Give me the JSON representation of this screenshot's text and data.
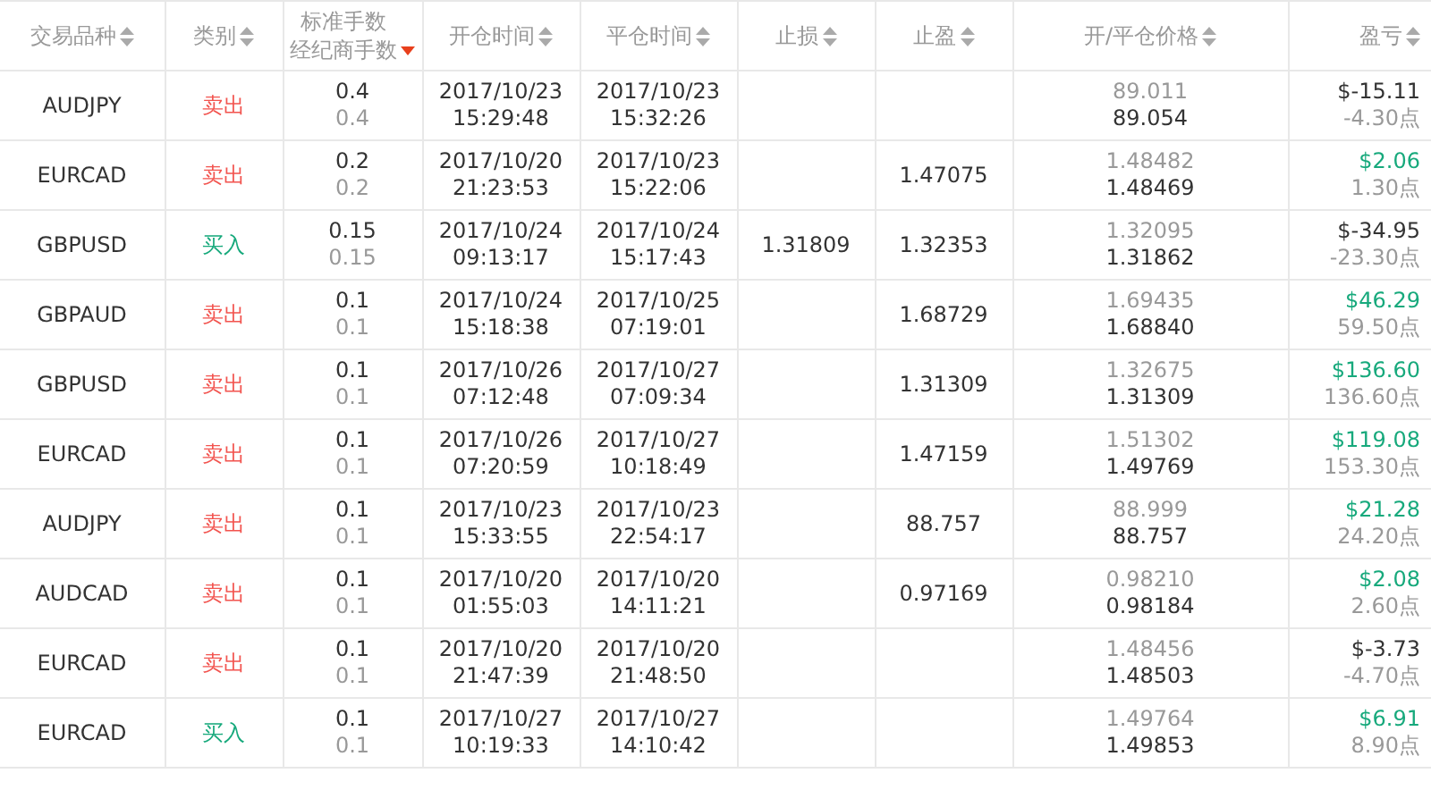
{
  "table": {
    "columns": [
      {
        "labels": [
          "交易品种"
        ],
        "sorted": false
      },
      {
        "labels": [
          "类别"
        ],
        "sorted": false
      },
      {
        "labels": [
          "标准手数",
          "经纪商手数"
        ],
        "sorted": true
      },
      {
        "labels": [
          "开仓时间"
        ],
        "sorted": false
      },
      {
        "labels": [
          "平仓时间"
        ],
        "sorted": false
      },
      {
        "labels": [
          "止损"
        ],
        "sorted": false
      },
      {
        "labels": [
          "止盈"
        ],
        "sorted": false
      },
      {
        "labels": [
          "开/平仓价格"
        ],
        "sorted": false
      },
      {
        "labels": [
          "盈亏"
        ],
        "sorted": false
      }
    ],
    "rows": [
      {
        "symbol": "AUDJPY",
        "side": {
          "label": "卖出",
          "kind": "sell"
        },
        "lots": [
          "0.4",
          "0.4"
        ],
        "open_time": [
          "2017/10/23",
          "15:29:48"
        ],
        "close_time": [
          "2017/10/23",
          "15:32:26"
        ],
        "prices": [
          "89.011",
          "89.054"
        ],
        "pnl": {
          "amount": "$-15.11",
          "points": "-4.30点",
          "kind": "loss"
        }
      },
      {
        "symbol": "EURCAD",
        "side": {
          "label": "卖出",
          "kind": "sell"
        },
        "lots": [
          "0.2",
          "0.2"
        ],
        "open_time": [
          "2017/10/20",
          "21:23:53"
        ],
        "close_time": [
          "2017/10/23",
          "15:22:06"
        ],
        "take_profit": "1.47075",
        "prices": [
          "1.48482",
          "1.48469"
        ],
        "pnl": {
          "amount": "$2.06",
          "points": "1.30点",
          "kind": "profit"
        }
      },
      {
        "symbol": "GBPUSD",
        "side": {
          "label": "买入",
          "kind": "buy"
        },
        "lots": [
          "0.15",
          "0.15"
        ],
        "open_time": [
          "2017/10/24",
          "09:13:17"
        ],
        "close_time": [
          "2017/10/24",
          "15:17:43"
        ],
        "stop_loss": "1.31809",
        "take_profit": "1.32353",
        "prices": [
          "1.32095",
          "1.31862"
        ],
        "pnl": {
          "amount": "$-34.95",
          "points": "-23.30点",
          "kind": "loss"
        }
      },
      {
        "symbol": "GBPAUD",
        "side": {
          "label": "卖出",
          "kind": "sell"
        },
        "lots": [
          "0.1",
          "0.1"
        ],
        "open_time": [
          "2017/10/24",
          "15:18:38"
        ],
        "close_time": [
          "2017/10/25",
          "07:19:01"
        ],
        "take_profit": "1.68729",
        "prices": [
          "1.69435",
          "1.68840"
        ],
        "pnl": {
          "amount": "$46.29",
          "points": "59.50点",
          "kind": "profit"
        }
      },
      {
        "symbol": "GBPUSD",
        "side": {
          "label": "卖出",
          "kind": "sell"
        },
        "lots": [
          "0.1",
          "0.1"
        ],
        "open_time": [
          "2017/10/26",
          "07:12:48"
        ],
        "close_time": [
          "2017/10/27",
          "07:09:34"
        ],
        "take_profit": "1.31309",
        "prices": [
          "1.32675",
          "1.31309"
        ],
        "pnl": {
          "amount": "$136.60",
          "points": "136.60点",
          "kind": "profit"
        }
      },
      {
        "symbol": "EURCAD",
        "side": {
          "label": "卖出",
          "kind": "sell"
        },
        "lots": [
          "0.1",
          "0.1"
        ],
        "open_time": [
          "2017/10/26",
          "07:20:59"
        ],
        "close_time": [
          "2017/10/27",
          "10:18:49"
        ],
        "take_profit": "1.47159",
        "prices": [
          "1.51302",
          "1.49769"
        ],
        "pnl": {
          "amount": "$119.08",
          "points": "153.30点",
          "kind": "profit"
        }
      },
      {
        "symbol": "AUDJPY",
        "side": {
          "label": "卖出",
          "kind": "sell"
        },
        "lots": [
          "0.1",
          "0.1"
        ],
        "open_time": [
          "2017/10/23",
          "15:33:55"
        ],
        "close_time": [
          "2017/10/23",
          "22:54:17"
        ],
        "take_profit": "88.757",
        "prices": [
          "88.999",
          "88.757"
        ],
        "pnl": {
          "amount": "$21.28",
          "points": "24.20点",
          "kind": "profit"
        }
      },
      {
        "symbol": "AUDCAD",
        "side": {
          "label": "卖出",
          "kind": "sell"
        },
        "lots": [
          "0.1",
          "0.1"
        ],
        "open_time": [
          "2017/10/20",
          "01:55:03"
        ],
        "close_time": [
          "2017/10/20",
          "14:11:21"
        ],
        "take_profit": "0.97169",
        "prices": [
          "0.98210",
          "0.98184"
        ],
        "pnl": {
          "amount": "$2.08",
          "points": "2.60点",
          "kind": "profit"
        }
      },
      {
        "symbol": "EURCAD",
        "side": {
          "label": "卖出",
          "kind": "sell"
        },
        "lots": [
          "0.1",
          "0.1"
        ],
        "open_time": [
          "2017/10/20",
          "21:47:39"
        ],
        "close_time": [
          "2017/10/20",
          "21:48:50"
        ],
        "prices": [
          "1.48456",
          "1.48503"
        ],
        "pnl": {
          "amount": "$-3.73",
          "points": "-4.70点",
          "kind": "loss"
        }
      },
      {
        "symbol": "EURCAD",
        "side": {
          "label": "买入",
          "kind": "buy"
        },
        "lots": [
          "0.1",
          "0.1"
        ],
        "open_time": [
          "2017/10/27",
          "10:19:33"
        ],
        "close_time": [
          "2017/10/27",
          "14:10:42"
        ],
        "prices": [
          "1.49764",
          "1.49853"
        ],
        "pnl": {
          "amount": "$6.91",
          "points": "8.90点",
          "kind": "profit"
        }
      }
    ]
  }
}
